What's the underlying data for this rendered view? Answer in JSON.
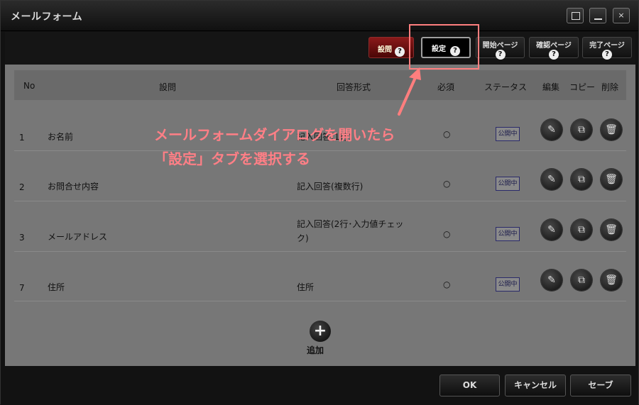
{
  "window": {
    "title": "メールフォーム",
    "close_glyph": "×"
  },
  "tabs": [
    {
      "label": "設問",
      "help": "?"
    },
    {
      "label": "設定",
      "help": "?"
    },
    {
      "label": "開始ページ",
      "help": "?"
    },
    {
      "label": "確認ページ",
      "help": "?"
    },
    {
      "label": "完了ページ",
      "help": "?"
    }
  ],
  "table": {
    "headers": {
      "no": "No",
      "question": "設問",
      "format": "回答形式",
      "required": "必須",
      "status": "ステータス",
      "edit": "編集",
      "copy": "コピー",
      "delete": "削除"
    },
    "rows": [
      {
        "no": "1",
        "question": "お名前",
        "format": "記入回答(1行)",
        "required": "○",
        "status": "公開中"
      },
      {
        "no": "2",
        "question": "お問合せ内容",
        "format": "記入回答(複数行)",
        "required": "○",
        "status": "公開中"
      },
      {
        "no": "3",
        "question": "メールアドレス",
        "format_line1": "記入回答(2行･入力値チェッ",
        "format_line2": "ク)",
        "required": "○",
        "status": "公開中"
      },
      {
        "no": "7",
        "question": "住所",
        "format": "住所",
        "required": "○",
        "status": "公開中"
      }
    ]
  },
  "add": {
    "label": "追加"
  },
  "annotation": {
    "line1": "メールフォームダイアログを開いたら",
    "line2": "「設定」タブを選択する"
  },
  "footer": {
    "ok": "OK",
    "cancel": "キャンセル",
    "save": "セーブ"
  },
  "colors": {
    "annotation": "#ff7f86",
    "highlight": "#ff7e7e",
    "active_tab": "#8a1a1a"
  }
}
